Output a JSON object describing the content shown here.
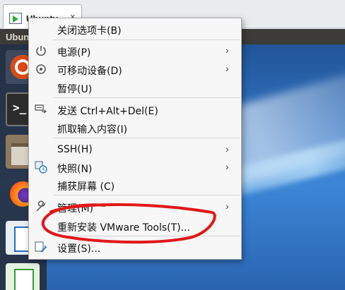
{
  "tab": {
    "title": "Ubuntu",
    "close_glyph": "×"
  },
  "guest": {
    "topbar_title": "Ubun"
  },
  "launcher": {
    "items": [
      {
        "icon": "ubuntu-logo-icon"
      },
      {
        "icon": "terminal-icon"
      },
      {
        "icon": "files-icon"
      },
      {
        "icon": "firefox-icon"
      },
      {
        "icon": "writer-icon"
      },
      {
        "icon": "calc-icon"
      }
    ]
  },
  "menu": {
    "close_tab": "关闭选项卡(B)",
    "power": "电源(P)",
    "removable": "可移动设备(D)",
    "pause": "暂停(U)",
    "send_cad": "发送 Ctrl+Alt+Del(E)",
    "grab_input": "抓取输入内容(I)",
    "ssh": "SSH(H)",
    "snapshot": "快照(N)",
    "capture_screen": "捕获屏幕 (C)",
    "manage": "管理(M)",
    "reinstall_tools": "重新安装 VMware Tools(T)...",
    "settings": "设置(S)...",
    "submenu_arrow": "›"
  },
  "colors": {
    "annotation_red": "#e01818"
  }
}
